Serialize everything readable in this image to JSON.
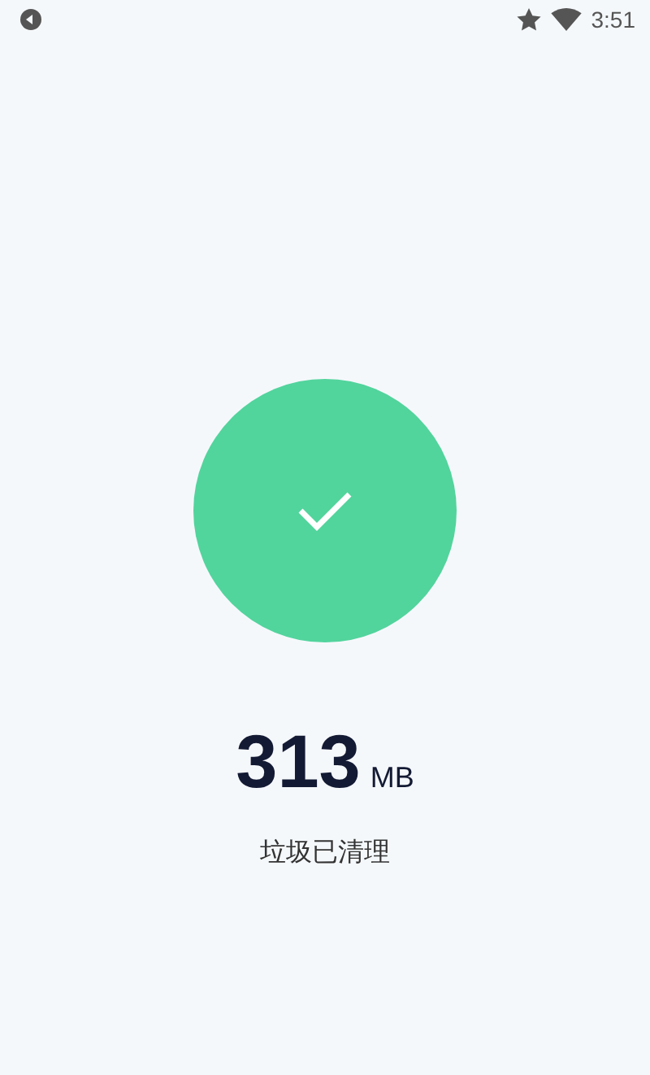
{
  "status_bar": {
    "time": "3:51"
  },
  "result": {
    "amount": "313",
    "unit": "MB",
    "message": "垃圾已清理"
  }
}
